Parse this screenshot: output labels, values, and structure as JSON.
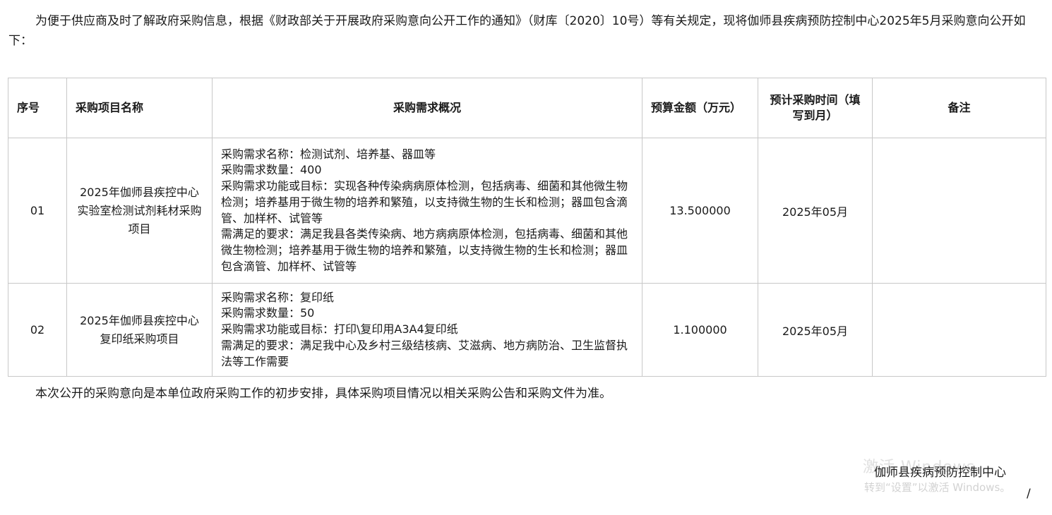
{
  "intro": {
    "text": "为便于供应商及时了解政府采购信息，根据《财政部关于开展政府采购意向公开工作的通知》（财库〔2020〕10号）等有关规定，现将伽师县疾病预防控制中心2025年5月采购意向公开如下："
  },
  "table": {
    "headers": {
      "no": "序号",
      "name": "采购项目名称",
      "desc": "采购需求概况",
      "budget": "预算金额（万元）",
      "time": "预计采购时间（填写到月）",
      "remark": "备注"
    },
    "rows": [
      {
        "no": "01",
        "name": "2025年伽师县疾控中心实验室检测试剂耗材采购项目",
        "desc": {
          "l1": "采购需求名称：检测试剂、培养基、器皿等",
          "l2": "采购需求数量：400",
          "l3": "采购需求功能或目标：实现各种传染病病原体检测，包括病毒、细菌和其他微生物检测；培养基用于微生物的培养和繁殖，以支持微生物的生长和检测；器皿包含滴管、加样杯、试管等",
          "l4": "需满足的要求：满足我县各类传染病、地方病病原体检测，包括病毒、细菌和其他微生物检测；培养基用于微生物的培养和繁殖，以支持微生物的生长和检测；器皿包含滴管、加样杯、试管等"
        },
        "budget": "13.500000",
        "time": "2025年05月",
        "remark": ""
      },
      {
        "no": "02",
        "name": "2025年伽师县疾控中心复印纸采购项目",
        "desc": {
          "l1": "采购需求名称：复印纸",
          "l2": "采购需求数量：50",
          "l3": "采购需求功能或目标：打印\\复印用A3A4复印纸",
          "l4": "需满足的要求：满足我中心及乡村三级结核病、艾滋病、地方病防治、卫生监督执法等工作需要"
        },
        "budget": "1.100000",
        "time": "2025年05月",
        "remark": ""
      }
    ]
  },
  "outro": {
    "text": "本次公开的采购意向是本单位政府采购工作的初步安排，具体采购项目情况以相关采购公告和采购文件为准。"
  },
  "watermark": {
    "title": "激活 Windows",
    "subtitle": "转到“设置”以激活 Windows。"
  },
  "signature": {
    "org": "伽师县疾病预防控制中心",
    "mark": "/"
  }
}
